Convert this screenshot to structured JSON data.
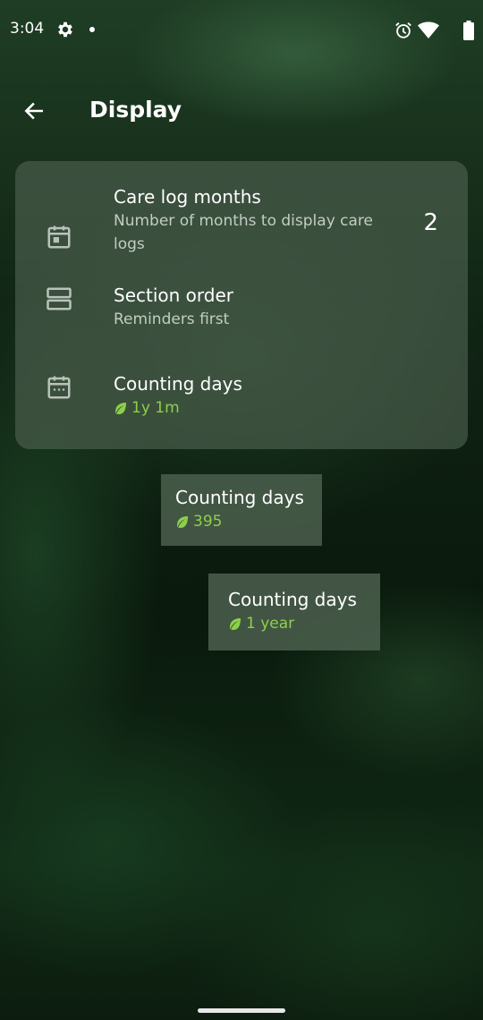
{
  "status_bar": {
    "time": "3:04"
  },
  "app_bar": {
    "title": "Display"
  },
  "settings": [
    {
      "title": "Care log months",
      "subtitle": "Number of months to display care logs",
      "value": "2"
    },
    {
      "title": "Section order",
      "subtitle": "Reminders first"
    },
    {
      "title": "Counting days",
      "value": "1y 1m"
    }
  ],
  "widgets": [
    {
      "title": "Counting days",
      "value": "395"
    },
    {
      "title": "Counting days",
      "value": "1 year"
    }
  ],
  "colors": {
    "accent_green": "#8fcf4a",
    "card": "#50645a"
  }
}
